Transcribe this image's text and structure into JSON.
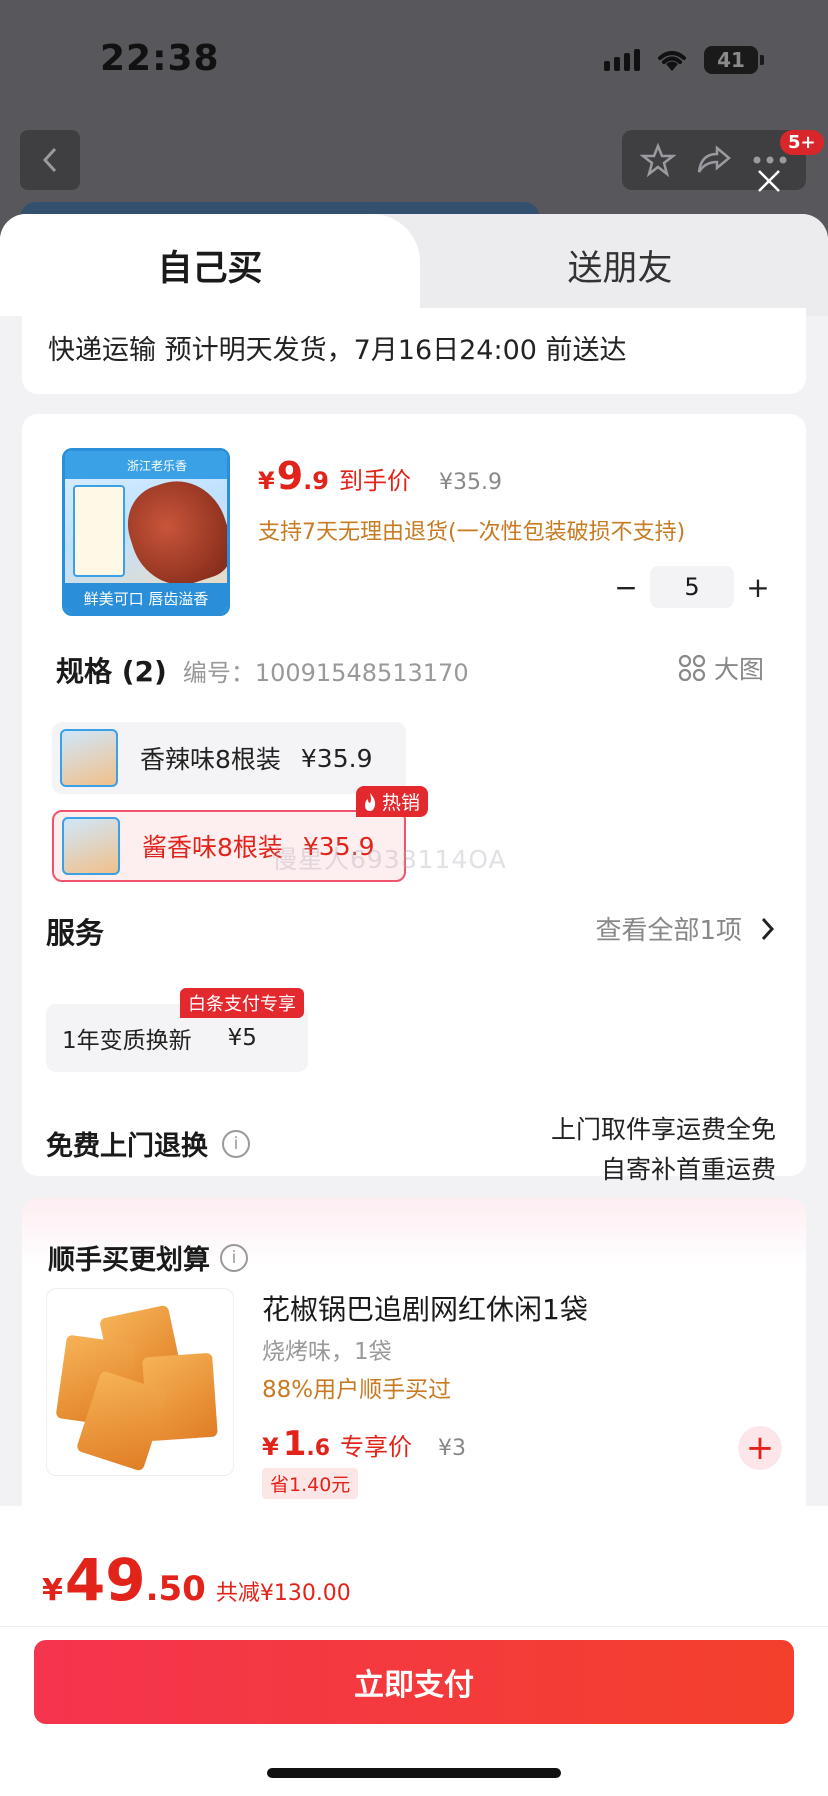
{
  "status_bar": {
    "time": "22:38",
    "battery": "41"
  },
  "background": {
    "cart_badge": "5+"
  },
  "tabs": [
    {
      "label": "自己买",
      "active": true
    },
    {
      "label": "送朋友",
      "active": false
    }
  ],
  "shipping": {
    "text": "快递运输 预计明天发货，7月16日24:00 前送达"
  },
  "product": {
    "thumb_top": "浙江老乐香",
    "thumb_bottom": "鲜美可口 唇齿溢香",
    "price_symbol": "¥",
    "price_int": "9",
    "price_dec": ".9",
    "price_label": "到手价",
    "original_price": "¥35.9",
    "return_note": "支持7天无理由退货(一次性包装破损不支持)",
    "quantity": "5",
    "qty_minus": "−",
    "qty_plus": "+"
  },
  "spec": {
    "title": "规格 (2)",
    "code": "编号：10091548513170",
    "bigpic_label": "大图",
    "options": [
      {
        "name": "香辣味8根装",
        "price": "¥35.9",
        "selected": false
      },
      {
        "name": "酱香味8根装",
        "price": "¥35.9",
        "selected": true
      }
    ],
    "hot_badge": "热销",
    "watermark": "慢星人6938114OA"
  },
  "service": {
    "title": "服务",
    "view_all": "查看全部1项",
    "item_name": "1年变质换新",
    "item_price": "¥5",
    "item_tag": "白条支付专享"
  },
  "returns": {
    "title": "免费上门退换",
    "line1": "上门取件享运费全免",
    "line2": "自寄补首重运费"
  },
  "addon": {
    "title": "顺手买更划算",
    "name": "花椒锅巴追剧网红休闲1袋",
    "spec": "烧烤味，1袋",
    "rate": "88%用户顺手买过",
    "price_symbol": "¥",
    "price_int": "1",
    "price_dec": ".6",
    "price_label": "专享价",
    "original_price": "¥3",
    "save": "省1.40元",
    "add": "+"
  },
  "footer": {
    "total_symbol": "¥",
    "total_int": "49",
    "total_dec": ".50",
    "total_save": "共减¥130.00",
    "pay_button": "立即支付"
  },
  "colors": {
    "accent": "#e2231a",
    "pay_button": "#f5344e",
    "warning": "#c77b22"
  }
}
